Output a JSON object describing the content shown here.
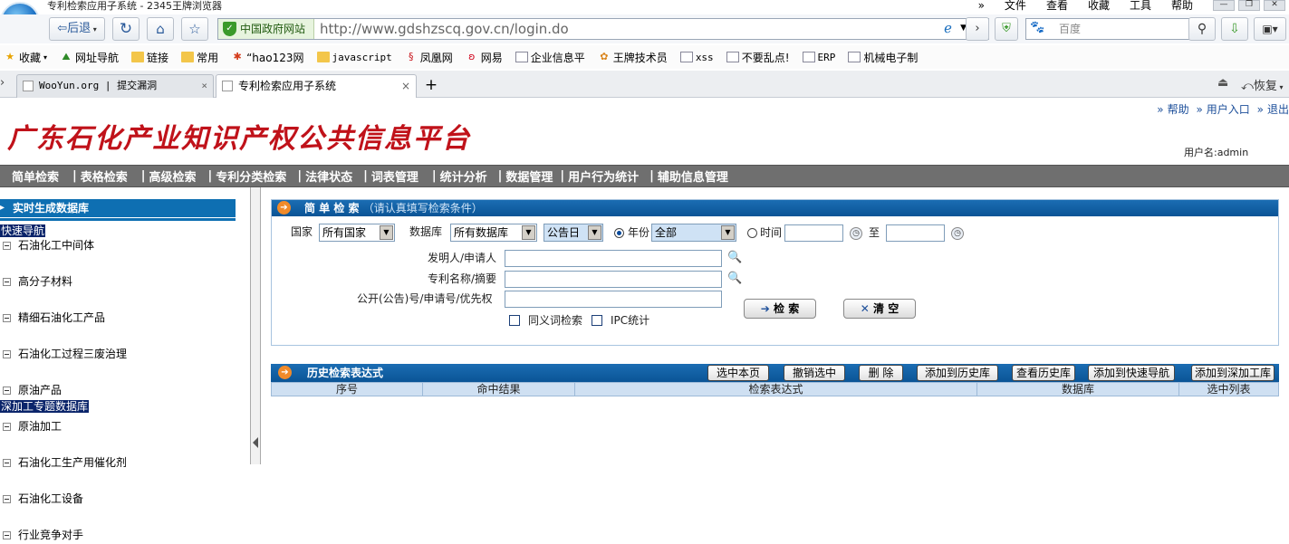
{
  "browser": {
    "window_title": "专利检索应用子系统 - 2345王牌浏览器",
    "menu": [
      "文件",
      "查看",
      "收藏",
      "工具",
      "帮助"
    ],
    "back_label": "后退",
    "site_badge": "中国政府网站",
    "url": "http://www.gdshzscq.gov.cn/login.do",
    "search_placeholder": "百度",
    "bookmarks": [
      "收藏",
      "网址导航",
      "链接",
      "常用",
      "“hao123网",
      "javascript",
      "凤凰网",
      "网易",
      "企业信息平",
      "王牌技术员",
      "xss",
      "不要乱点!",
      "ERP",
      "机械电子制"
    ],
    "tabs": [
      "WooYun.org | 提交漏洞",
      "专利检索应用子系统"
    ],
    "restore_label": "恢复"
  },
  "header": {
    "site_title": "广东石化产业知识产权公共信息平台",
    "links": [
      "帮助",
      "用户入口",
      "退出"
    ],
    "username_label": "用户名:admin"
  },
  "main_nav": [
    "简单检索",
    "表格检索",
    "高级检索",
    "专利分类检索",
    "法律状态",
    "词表管理",
    "统计分析",
    "数据管理",
    "用户行为统计",
    "辅助信息管理"
  ],
  "sidebar": {
    "header": "实时生成数据库",
    "quick_nav": "快速导航",
    "items": [
      "石油化工中间体",
      "高分子材料",
      "精细石油化工产品",
      "石油化工过程三废治理",
      "原油产品",
      "原油加工",
      "石油化工生产用催化剂",
      "石油化工设备",
      "行业竞争对手"
    ],
    "footer": "深加工专题数据库"
  },
  "search_panel": {
    "title": "简 单 检 索",
    "subtitle": "（请认真填写检索条件）",
    "country_label": "国家",
    "country_value": "所有国家",
    "db_label": "数据库",
    "db_value": "所有数据库",
    "date_type": "公告日",
    "year_label": "年份",
    "year_value": "全部",
    "time_label": "时间",
    "to_label": "至",
    "inventor_label": "发明人/申请人",
    "title_label": "专利名称/摘要",
    "number_label": "公开(公告)号/申请号/优先权",
    "synonym_label": "同义词检索",
    "ipc_label": "IPC统计",
    "search_button": "检 索",
    "clear_button": "清 空"
  },
  "history_panel": {
    "title": "历史检索表达式",
    "buttons": [
      "选中本页",
      "撤销选中",
      "删 除",
      "添加到历史库",
      "查看历史库",
      "添加到快速导航",
      "添加到深加工库"
    ],
    "columns": [
      "序号",
      "命中结果",
      "检索表达式",
      "数据库",
      "选中列表"
    ]
  }
}
